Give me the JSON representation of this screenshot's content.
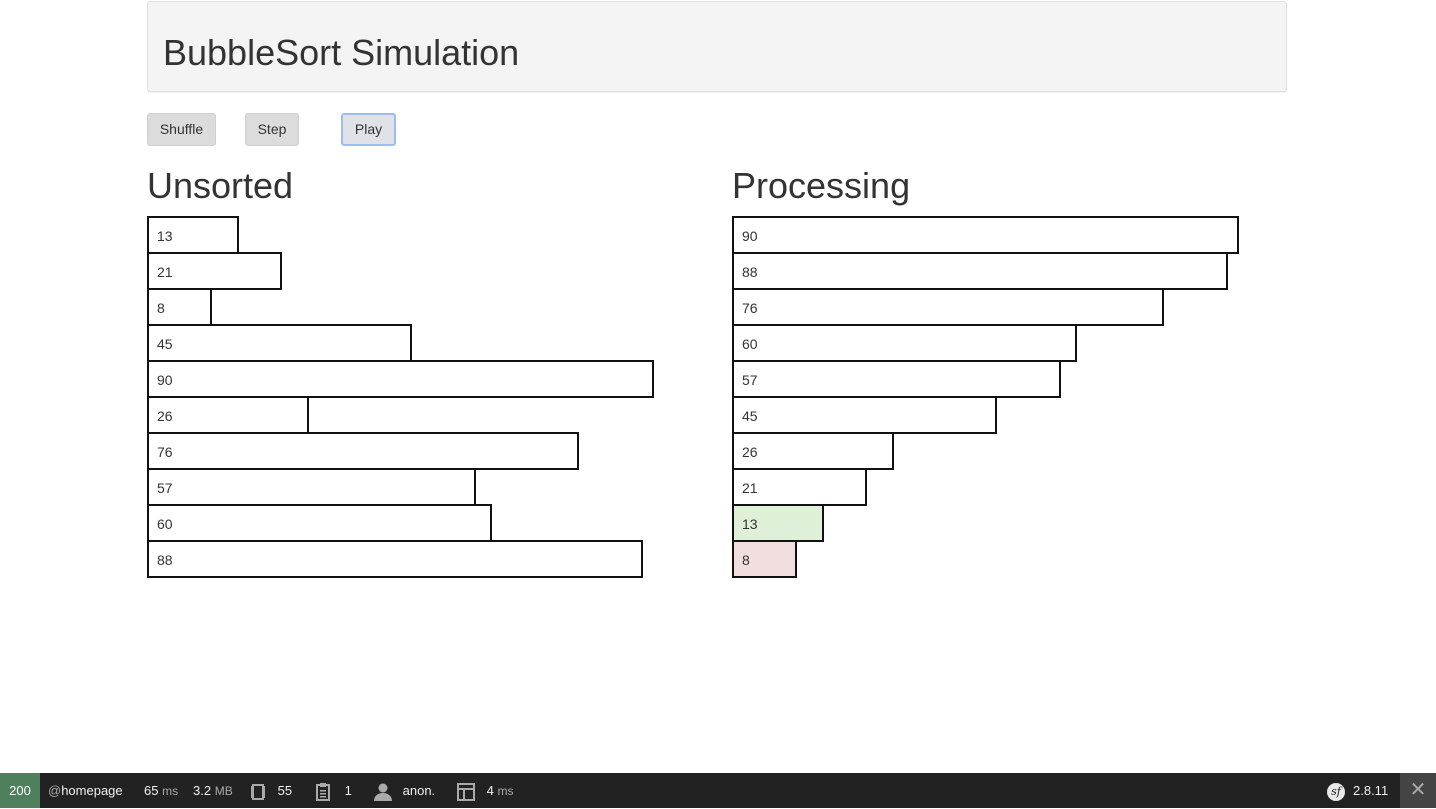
{
  "header": {
    "title": "BubbleSort Simulation"
  },
  "controls": {
    "shuffle_label": "Shuffle",
    "step_label": "Step",
    "play_label": "Play"
  },
  "unsorted": {
    "title": "Unsorted",
    "items": [
      {
        "label": "13",
        "value": 13
      },
      {
        "label": "21",
        "value": 21
      },
      {
        "label": "8",
        "value": 8
      },
      {
        "label": "45",
        "value": 45
      },
      {
        "label": "90",
        "value": 90
      },
      {
        "label": "26",
        "value": 26
      },
      {
        "label": "76",
        "value": 76
      },
      {
        "label": "57",
        "value": 57
      },
      {
        "label": "60",
        "value": 60
      },
      {
        "label": "88",
        "value": 88
      }
    ]
  },
  "processing": {
    "title": "Processing",
    "items": [
      {
        "label": "90",
        "value": 90,
        "state": "normal"
      },
      {
        "label": "88",
        "value": 88,
        "state": "normal"
      },
      {
        "label": "76",
        "value": 76,
        "state": "normal"
      },
      {
        "label": "60",
        "value": 60,
        "state": "normal"
      },
      {
        "label": "57",
        "value": 57,
        "state": "normal"
      },
      {
        "label": "45",
        "value": 45,
        "state": "normal"
      },
      {
        "label": "26",
        "value": 26,
        "state": "normal"
      },
      {
        "label": "21",
        "value": 21,
        "state": "normal"
      },
      {
        "label": "13",
        "value": 13,
        "state": "green"
      },
      {
        "label": "8",
        "value": 8,
        "state": "red"
      }
    ]
  },
  "colors": {
    "green": "#dff0d8",
    "red": "#f2dede",
    "status_ok": "#4f805d",
    "toolbar_bg": "#222222"
  },
  "toolbar": {
    "status": "200",
    "route_prefix": "@",
    "route": "homepage",
    "time_value": "65",
    "time_unit": "ms",
    "memory_value": "3.2",
    "memory_unit": "MB",
    "queries_icon": "queries-icon",
    "queries_count": "55",
    "logs_icon": "log-icon",
    "logs_count": "1",
    "user_icon": "user-icon",
    "user": "anon.",
    "twig_icon": "template-icon",
    "twig_time_value": "4",
    "twig_time_unit": "ms",
    "symfony_logo": "sf",
    "version": "2.8.11"
  }
}
